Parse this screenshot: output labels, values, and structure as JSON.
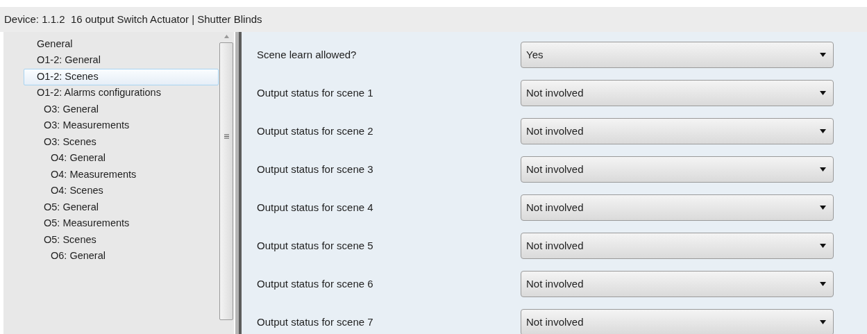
{
  "header": {
    "title": "Device: 1.1.2  16 output Switch Actuator | Shutter Blinds"
  },
  "tree": [
    {
      "label": "General",
      "selected": false
    },
    {
      "label": "O1-2: General",
      "selected": false
    },
    {
      "label": "O1-2: Scenes",
      "selected": true
    },
    {
      "label": "O1-2: Alarms configurations",
      "selected": false,
      "children": [
        {
          "label": "O3: General",
          "selected": false
        },
        {
          "label": "O3: Measurements",
          "selected": false
        },
        {
          "label": "O3: Scenes",
          "selected": false,
          "children": [
            {
              "label": "O4: General",
              "selected": false
            },
            {
              "label": "O4: Measurements",
              "selected": false
            },
            {
              "label": "O4: Scenes",
              "selected": false
            }
          ]
        },
        {
          "label": "O5: General",
          "selected": false
        },
        {
          "label": "O5: Measurements",
          "selected": false
        },
        {
          "label": "O5: Scenes",
          "selected": false,
          "children": [
            {
              "label": "O6: General",
              "selected": false
            }
          ]
        }
      ]
    }
  ],
  "parameters": [
    {
      "label": "Scene learn allowed?",
      "value": "Yes"
    },
    {
      "label": "Output status for scene 1",
      "value": "Not involved"
    },
    {
      "label": "Output status for scene 2",
      "value": "Not involved"
    },
    {
      "label": "Output status for scene 3",
      "value": "Not involved"
    },
    {
      "label": "Output status for scene 4",
      "value": "Not involved"
    },
    {
      "label": "Output status for scene 5",
      "value": "Not involved"
    },
    {
      "label": "Output status for scene 6",
      "value": "Not involved"
    },
    {
      "label": "Output status for scene 7",
      "value": "Not involved"
    }
  ]
}
